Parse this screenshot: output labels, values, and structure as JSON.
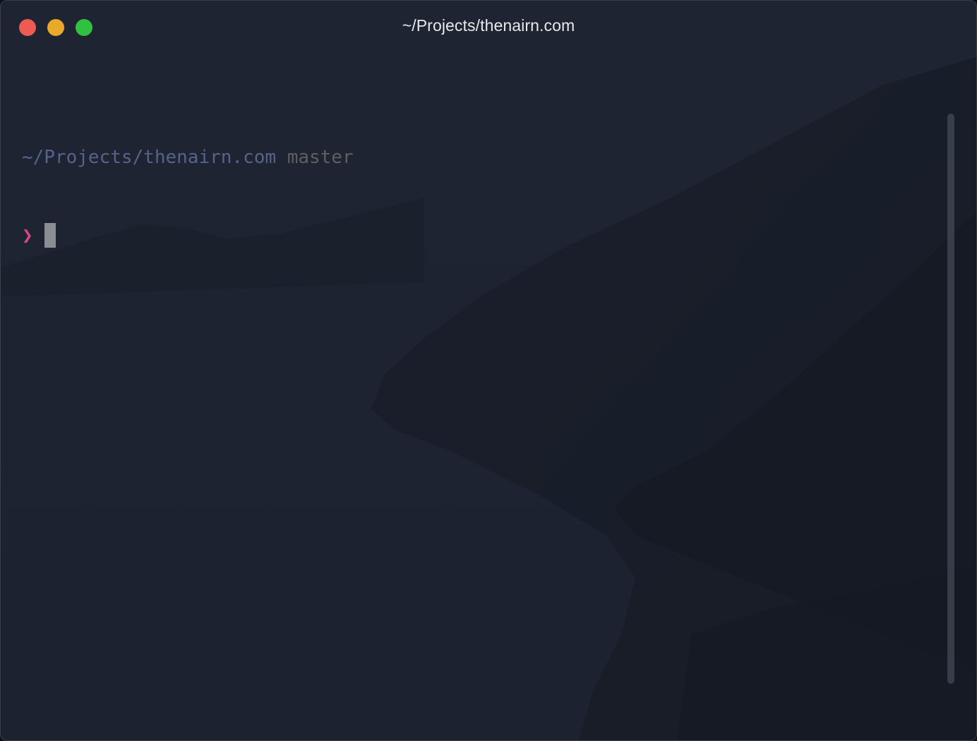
{
  "window": {
    "title": "~/Projects/thenairn.com"
  },
  "colors": {
    "close": "#ee5b52",
    "minimize": "#e9a92a",
    "zoom": "#2fc13f",
    "cursor": "#8a8d93",
    "background": "#1d2330"
  },
  "terminal": {
    "cwd": "~/Projects/thenairn.com",
    "branch": "master",
    "prompt_symbol": "❯"
  }
}
